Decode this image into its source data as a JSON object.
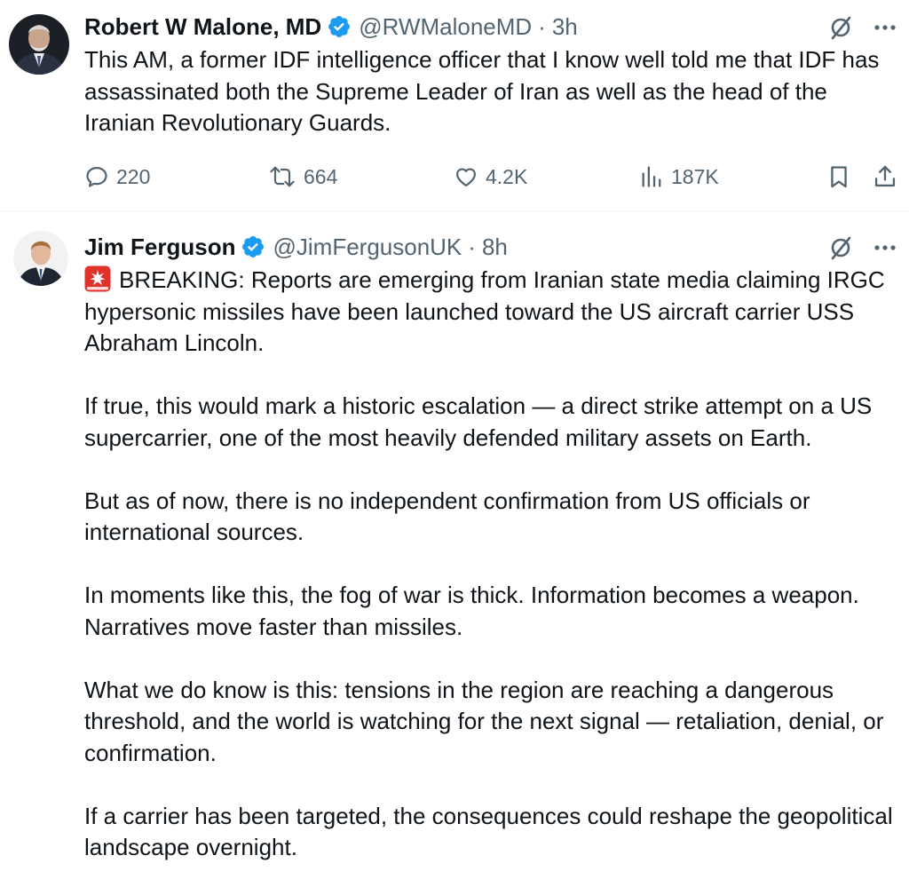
{
  "tweets": [
    {
      "display_name": "Robert W Malone, MD",
      "handle": "@RWMaloneMD",
      "separator": "·",
      "time": "3h",
      "paragraphs": [
        "This AM, a former IDF intelligence officer that I know well told me that IDF has assassinated both the Supreme Leader of Iran as well as the head of the Iranian Revolutionary Guards."
      ],
      "stats": {
        "replies": "220",
        "reposts": "664",
        "likes": "4.2K",
        "views": "187K"
      }
    },
    {
      "display_name": "Jim Ferguson",
      "handle": "@JimFergusonUK",
      "separator": "·",
      "time": "8h",
      "first_paragraph": "BREAKING: Reports are emerging from Iranian state media claiming IRGC hypersonic missiles have been launched toward the US aircraft carrier USS Abraham Lincoln.",
      "paragraphs": [
        "If true, this would mark a historic escalation — a direct strike attempt on a US supercarrier, one of the most heavily defended military assets on Earth.",
        "But as of now, there is no independent confirmation from US officials or international sources.",
        "In moments like this, the fog of war is thick. Information becomes a weapon. Narratives move faster than missiles.",
        "What we do know is this: tensions in the region are reaching a dangerous threshold, and the world is watching for the next signal — retaliation, denial, or confirmation.",
        "If a carrier has been targeted, the consequences could reshape the geopolitical landscape overnight."
      ]
    }
  ],
  "icons": {
    "verified": "verified-badge-icon",
    "grok": "grok-icon",
    "more": "more-icon",
    "reply": "reply-icon",
    "repost": "repost-icon",
    "like": "like-icon",
    "views": "views-icon",
    "bookmark": "bookmark-icon",
    "share": "share-icon",
    "siren": "siren-emoji-icon"
  },
  "colors": {
    "text": "#0f1419",
    "secondary": "#536471",
    "verified_blue": "#1d9bf0",
    "divider": "#eff3f4",
    "siren_red": "#e0312b"
  }
}
